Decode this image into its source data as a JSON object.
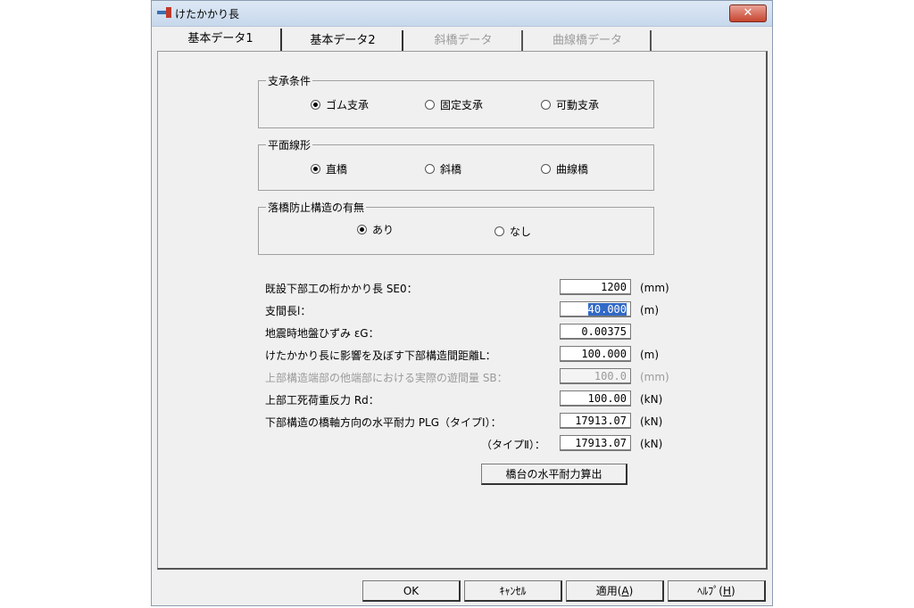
{
  "window": {
    "title": "けたかかり長"
  },
  "tabs": [
    {
      "label": "基本データ1",
      "active": true,
      "enabled": true
    },
    {
      "label": "基本データ2",
      "active": false,
      "enabled": true
    },
    {
      "label": "斜橋データ",
      "active": false,
      "enabled": false
    },
    {
      "label": "曲線橋データ",
      "active": false,
      "enabled": false
    }
  ],
  "support_condition": {
    "label": "支承条件",
    "options": [
      "ゴム支承",
      "固定支承",
      "可動支承"
    ],
    "selected": "ゴム支承"
  },
  "plan_alignment": {
    "label": "平面線形",
    "options": [
      "直橋",
      "斜橋",
      "曲線橋"
    ],
    "selected": "直橋"
  },
  "fall_prevention": {
    "label": "落橋防止構造の有無",
    "options": [
      "あり",
      "なし"
    ],
    "selected": "あり"
  },
  "fields": [
    {
      "label": "既設下部工の桁かかり長 SE0：",
      "value": "1200",
      "unit": "(mm)",
      "enabled": true
    },
    {
      "label": "支間長l：",
      "value": "40.000",
      "unit": "(m)",
      "enabled": true,
      "selected": true
    },
    {
      "label": "地震時地盤ひずみ εG：",
      "value": "0.00375",
      "unit": "",
      "enabled": true
    },
    {
      "label": "けたかかり長に影響を及ぼす下部構造間距離L：",
      "value": "100.000",
      "unit": "(m)",
      "enabled": true
    },
    {
      "label": "上部構造端部の他端部における実際の遊間量 SB：",
      "value": "100.0",
      "unit": "(mm)",
      "enabled": false
    },
    {
      "label": "上部工死荷重反力 Rd：",
      "value": "100.00",
      "unit": "(kN)",
      "enabled": true
    },
    {
      "label": "下部構造の橋軸方向の水平耐力 PLG（タイプⅠ）：",
      "value": "17913.07",
      "unit": "(kN)",
      "enabled": true
    },
    {
      "label": "（タイプⅡ）：",
      "value": "17913.07",
      "unit": "(kN)",
      "enabled": true
    }
  ],
  "compute_button": "橋台の水平耐力算出",
  "footer": {
    "ok": "OK",
    "cancel": "ｷｬﾝｾﾙ",
    "apply_prefix": "適用(",
    "apply_key": "A",
    "apply_suffix": ")",
    "help_prefix": "ﾍﾙﾌﾟ(",
    "help_key": "H",
    "help_suffix": ")"
  },
  "colors": {
    "selection": "#3169c6",
    "close_button": "#c7452f"
  },
  "icons": {
    "app": "app-icon",
    "close": "close-icon"
  }
}
